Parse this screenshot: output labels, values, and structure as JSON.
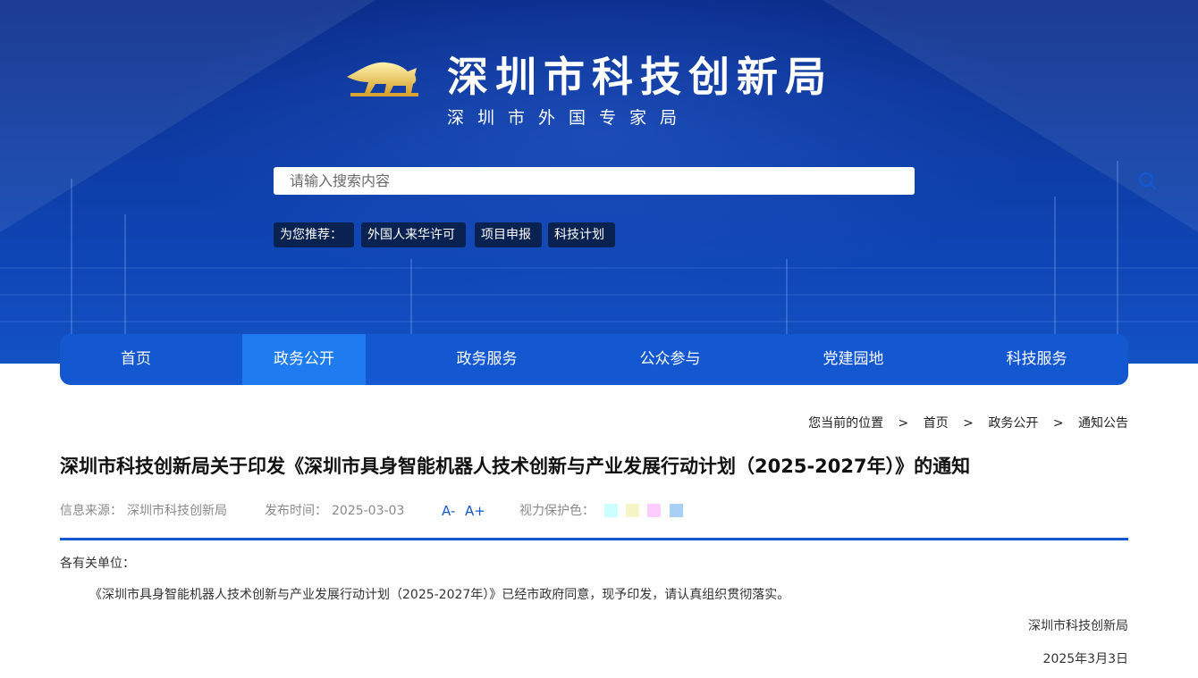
{
  "header": {
    "title": "深圳市科技创新局",
    "subtitle": "深圳市外国专家局"
  },
  "search": {
    "placeholder": "请输入搜索内容",
    "value": ""
  },
  "recommend": {
    "label": "为您推荐：",
    "tags": [
      "外国人来华许可",
      "项目申报",
      "科技计划"
    ]
  },
  "nav": {
    "items": [
      "首页",
      "政务公开",
      "政务服务",
      "公众参与",
      "党建园地",
      "科技服务"
    ],
    "active": "政务公开"
  },
  "breadcrumb": {
    "prefix": "您当前的位置",
    "items": [
      "首页",
      "政务公开",
      "通知公告"
    ],
    "separator": ">"
  },
  "article": {
    "title": "深圳市科技创新局关于印发《深圳市具身智能机器人技术创新与产业发展行动计划（2025-2027年）》的通知",
    "source_label": "信息来源：",
    "source": "深圳市科技创新局",
    "date_label": "发布时间：",
    "date": "2025-03-03",
    "font_smaller": "A-",
    "font_larger": "A+",
    "eye_care_label": "视力保护色：",
    "eye_care_colors": [
      "#ccffff",
      "#f5f5c8",
      "#ffccff",
      "#a8cff5"
    ],
    "salutation": "各有关单位：",
    "body": "《深圳市具身智能机器人技术创新与产业发展行动计划（2025-2027年）》已经市政府同意，现予印发，请认真组织贯彻落实。",
    "signature_org": "深圳市科技创新局",
    "signature_date": "2025年3月3日"
  },
  "colors": {
    "primary": "#1358d0",
    "nav_active": "#1e7cf0",
    "banner_dark": "#0a2c8a"
  }
}
